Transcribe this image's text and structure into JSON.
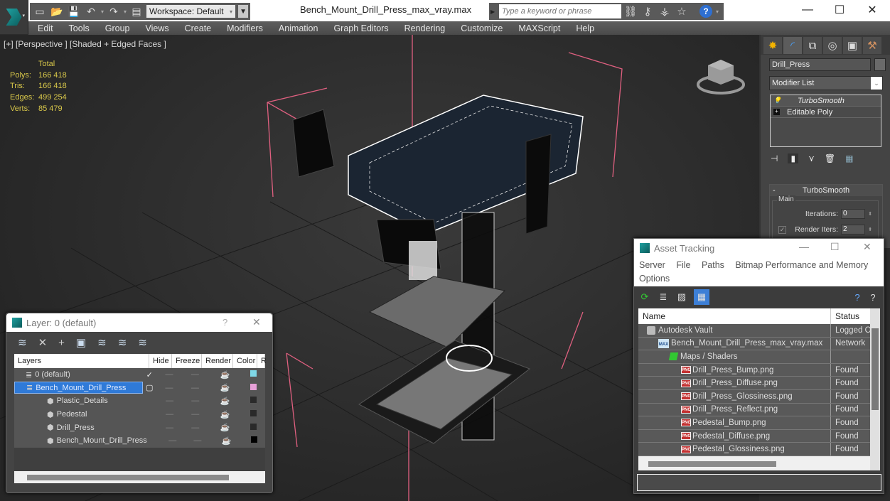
{
  "title_bar": {
    "workspace_label": "Workspace: Default",
    "file_title": "Bench_Mount_Drill_Press_max_vray.max",
    "search_placeholder": "Type a keyword or phrase",
    "min": "—",
    "max": "☐",
    "close": "✕"
  },
  "menu": [
    "Edit",
    "Tools",
    "Group",
    "Views",
    "Create",
    "Modifiers",
    "Animation",
    "Graph Editors",
    "Rendering",
    "Customize",
    "MAXScript",
    "Help"
  ],
  "viewport": {
    "label": "[+] [Perspective ] [Shaded + Edged Faces ]",
    "stats": {
      "header": "Total",
      "rows": [
        {
          "k": "Polys:",
          "v": "166 418"
        },
        {
          "k": "Tris:",
          "v": "166 418"
        },
        {
          "k": "Edges:",
          "v": "499 254"
        },
        {
          "k": "Verts:",
          "v": "85 479"
        }
      ]
    }
  },
  "command_panel": {
    "object_name": "Drill_Press",
    "modifier_list": "Modifier List",
    "stack": [
      "TurboSmooth",
      "Editable Poly"
    ],
    "rollout_title": "TurboSmooth",
    "group_label": "Main",
    "iterations_label": "Iterations:",
    "iterations_value": "0",
    "render_iters_label": "Render Iters:",
    "render_iters_value": "2",
    "render_iters_checked": true
  },
  "asset_tracking": {
    "title": "Asset Tracking",
    "menu": [
      "Server",
      "File",
      "Paths",
      "Bitmap Performance and Memory",
      "Options"
    ],
    "columns": [
      "Name",
      "Status"
    ],
    "rows": [
      {
        "name": "Autodesk Vault",
        "status": "Logged O",
        "icon": "vault",
        "indent": 1
      },
      {
        "name": "Bench_Mount_Drill_Press_max_vray.max",
        "status": "Network",
        "icon": "max",
        "indent": 2
      },
      {
        "name": "Maps / Shaders",
        "status": "",
        "icon": "maps",
        "indent": 3
      },
      {
        "name": "Drill_Press_Bump.png",
        "status": "Found",
        "icon": "png",
        "indent": 4
      },
      {
        "name": "Drill_Press_Diffuse.png",
        "status": "Found",
        "icon": "png",
        "indent": 4
      },
      {
        "name": "Drill_Press_Glossiness.png",
        "status": "Found",
        "icon": "png",
        "indent": 4
      },
      {
        "name": "Drill_Press_Reflect.png",
        "status": "Found",
        "icon": "png",
        "indent": 4
      },
      {
        "name": "Pedestal_Bump.png",
        "status": "Found",
        "icon": "png",
        "indent": 4
      },
      {
        "name": "Pedestal_Diffuse.png",
        "status": "Found",
        "icon": "png",
        "indent": 4
      },
      {
        "name": "Pedestal_Glossiness.png",
        "status": "Found",
        "icon": "png",
        "indent": 4
      }
    ]
  },
  "layer_dialog": {
    "title": "Layer: 0 (default)",
    "help": "?",
    "close": "✕",
    "columns": [
      "Layers",
      "Hide",
      "Freeze",
      "Render",
      "Color",
      "R"
    ],
    "rows": [
      {
        "name": "0 (default)",
        "active": "✓",
        "color": "#7fd7e6",
        "indent": 1,
        "selected": false
      },
      {
        "name": "Bench_Mount_Drill_Press",
        "active": "",
        "color": "#e6a0d8",
        "indent": 1,
        "selected": true
      },
      {
        "name": "Plastic_Details",
        "active": "",
        "color": "#2a2a2a",
        "indent": 2,
        "selected": false
      },
      {
        "name": "Pedestal",
        "active": "",
        "color": "#2a2a2a",
        "indent": 2,
        "selected": false
      },
      {
        "name": "Drill_Press",
        "active": "",
        "color": "#2a2a2a",
        "indent": 2,
        "selected": false
      },
      {
        "name": "Bench_Mount_Drill_Press",
        "active": "",
        "color": "#000000",
        "indent": 2,
        "selected": false
      }
    ]
  }
}
